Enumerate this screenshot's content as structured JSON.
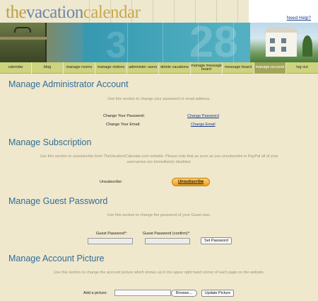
{
  "logo": {
    "part1": "the",
    "part2": "vacation",
    "part3": "calendar"
  },
  "header": {
    "help_link": "Need Help?"
  },
  "banner": {
    "num_left": "3",
    "num_right": "28"
  },
  "nav": {
    "items": [
      {
        "label": "calendar"
      },
      {
        "label": "blog"
      },
      {
        "label": "manage rooms"
      },
      {
        "label": "manage visitors"
      },
      {
        "label": "administer users"
      },
      {
        "label": "delete vacations"
      },
      {
        "label": "manage message board"
      },
      {
        "label": "message board"
      },
      {
        "label": "manage account",
        "active": true
      },
      {
        "label": "log out"
      }
    ]
  },
  "admin": {
    "title": "Manage Administrator Account",
    "desc": "Use this section to change your password or email address.",
    "change_password_label": "Change Your Password:",
    "change_password_link": "Change Password",
    "change_email_label": "Change Your Email:",
    "change_email_link": "Change Email"
  },
  "subscription": {
    "title": "Manage Subscription",
    "desc": "Use this section to unsubscribe from TheVacationCalendar.com website. Please note that as soon as you unsubscribe in PayPal all of your usernames are immediately disabled.",
    "unsubscribe_label": "Unsubscribe:",
    "unsubscribe_button": "Unsubscribe"
  },
  "guest": {
    "title": "Manage Guest Password",
    "desc": "Use this section to change the password of your Guest user.",
    "password_label": "Guest Password*:",
    "password_value": "",
    "confirm_label": "Guest Password (confirm)*:",
    "confirm_value": "",
    "set_button": "Set Password"
  },
  "picture": {
    "title": "Manage Account Picture",
    "desc": "Use this section to change the account picture which shows up in the upper right hand corner of each page on the website.",
    "add_label": "Add a picture:",
    "file_value": "",
    "browse_button": "Browse...",
    "update_button": "Update Picture"
  },
  "colors": {
    "title_blue": "#2f6d9a",
    "nav_bg": "#cdd37e",
    "nav_active": "#a2a65a",
    "page_bg": "#f0e8cc",
    "link_blue": "#1a3d8f"
  }
}
